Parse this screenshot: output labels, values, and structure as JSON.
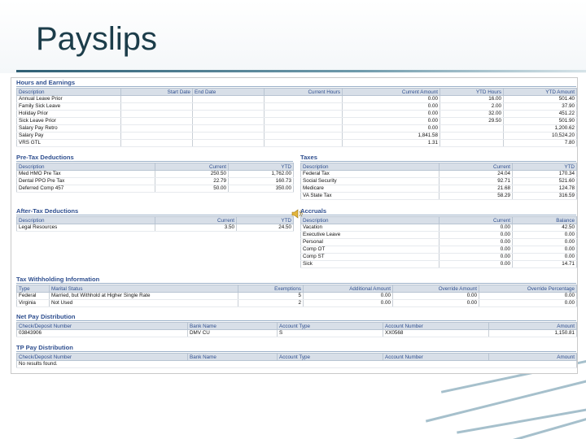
{
  "slide": {
    "title": "Payslips"
  },
  "hours_and_earnings": {
    "title": "Hours and Earnings",
    "columns": [
      "Description",
      "Start Date",
      "End Date",
      "Current Hours",
      "Current Amount",
      "YTD Hours",
      "YTD Amount"
    ],
    "rows": [
      [
        "Annual Leave Prior",
        "",
        "",
        "",
        "0.00",
        "16.00",
        "501.40"
      ],
      [
        "Family Sick Leave",
        "",
        "",
        "",
        "0.00",
        "2.00",
        "37.90"
      ],
      [
        "Holiday Prior",
        "",
        "",
        "",
        "0.00",
        "32.00",
        "451.22"
      ],
      [
        "Sick Leave Prior",
        "",
        "",
        "",
        "0.00",
        "29.50",
        "501.90"
      ],
      [
        "Salary Pay Retro",
        "",
        "",
        "",
        "0.00",
        "",
        "1,200.62"
      ],
      [
        "Salary Pay",
        "",
        "",
        "",
        "1,841.58",
        "",
        "10,524.20"
      ],
      [
        "VRS GTL",
        "",
        "",
        "",
        "1.31",
        "",
        "7.80"
      ]
    ]
  },
  "pretax": {
    "title": "Pre-Tax Deductions",
    "columns": [
      "Description",
      "Current",
      "YTD"
    ],
    "rows": [
      [
        "Med HMO Pre Tax",
        "250.50",
        "1,762.00"
      ],
      [
        "Dental PPO Pre Tax",
        "22.79",
        "160.73"
      ],
      [
        "Deferred Comp 457",
        "50.00",
        "350.00"
      ]
    ]
  },
  "taxes": {
    "title": "Taxes",
    "columns": [
      "Description",
      "Current",
      "YTD"
    ],
    "rows": [
      [
        "Federal Tax",
        "24.04",
        "170.34"
      ],
      [
        "Social Security",
        "92.71",
        "521.60"
      ],
      [
        "Medicare",
        "21.68",
        "124.78"
      ],
      [
        "VA State Tax",
        "58.29",
        "316.59"
      ]
    ]
  },
  "aftertax": {
    "title": "After-Tax Deductions",
    "columns": [
      "Description",
      "Current",
      "YTD"
    ],
    "rows": [
      [
        "Legal Resources",
        "3.50",
        "24.50"
      ]
    ]
  },
  "accruals": {
    "title": "Accruals",
    "columns": [
      "Description",
      "Current",
      "Balance"
    ],
    "rows": [
      [
        "Vacation",
        "0.00",
        "42.50"
      ],
      [
        "Executive Leave",
        "0.00",
        "0.00"
      ],
      [
        "Personal",
        "0.00",
        "0.00"
      ],
      [
        "Comp OT",
        "0.00",
        "0.00"
      ],
      [
        "Comp ST",
        "0.00",
        "0.00"
      ],
      [
        "Sick",
        "0.00",
        "14.71"
      ]
    ]
  },
  "tax_withholding": {
    "title": "Tax Withholding Information",
    "columns": [
      "Type",
      "Marital Status",
      "Exemptions",
      "Additional Amount",
      "Override Amount",
      "Override Percentage"
    ],
    "rows": [
      [
        "Federal",
        "Married, but Withhold at Higher Single Rate",
        "5",
        "0.00",
        "0.00",
        "0.00"
      ],
      [
        "Virginia",
        "Not Used",
        "2",
        "0.00",
        "0.00",
        "0.00"
      ]
    ]
  },
  "net_pay": {
    "title": "Net Pay Distribution",
    "columns": [
      "Check/Deposit Number",
      "Bank Name",
      "Account Type",
      "Account Number",
      "Amount"
    ],
    "rows": [
      [
        "03843906",
        "DMV CU",
        "S",
        "XX0568",
        "1,150.81"
      ]
    ]
  },
  "tp_pay": {
    "title": "TP Pay Distribution",
    "columns": [
      "Check/Deposit Number",
      "Bank Name",
      "Account Type",
      "Account Number",
      "Amount"
    ],
    "empty_text": "No results found."
  },
  "colors": {
    "title": "#1c3d4a",
    "section_title": "#2f4f8f",
    "header_bg": "#d8dfe8",
    "rule": "#2f5f74"
  },
  "icons": {
    "speaker": "speaker-icon"
  }
}
